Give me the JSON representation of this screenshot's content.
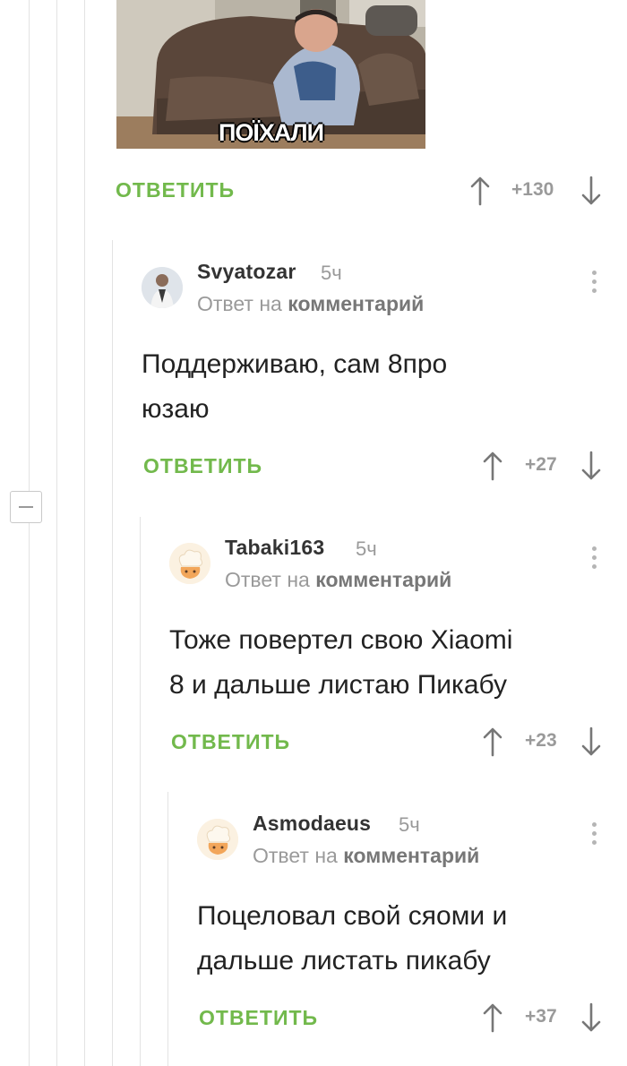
{
  "meme": {
    "caption": "ПОЇХАЛИ"
  },
  "top_actions": {
    "reply_label": "ОТВЕТИТЬ",
    "score": "+130"
  },
  "comments": [
    {
      "author": "Svyatozar",
      "time": "5ч",
      "reply_prefix": "Ответ на",
      "reply_link": "комментарий",
      "text_line1": "Поддерживаю, сам 8про",
      "text_line2": "юзаю",
      "reply_label": "ОТВЕТИТЬ",
      "score": "+27"
    },
    {
      "author": "Tabaki163",
      "time": "5ч",
      "reply_prefix": "Ответ на",
      "reply_link": "комментарий",
      "text_line1": "Тоже повертел свою Xiaomi",
      "text_line2": "8 и дальше листаю Пикабу",
      "reply_label": "ОТВЕТИТЬ",
      "score": "+23"
    },
    {
      "author": "Asmodaeus",
      "time": "5ч",
      "reply_prefix": "Ответ на",
      "reply_link": "комментарий",
      "text_line1": "Поцеловал свой сяоми и",
      "text_line2": "дальше листать пикабу",
      "reply_label": "ОТВЕТИТЬ",
      "score": "+37"
    }
  ],
  "icons": {
    "upvote": "arrow-up-icon",
    "downvote": "arrow-down-icon",
    "menu": "more-vertical-icon",
    "collapse": "minus-icon"
  },
  "colors": {
    "accent_green": "#72b94c",
    "muted_gray": "#9a9a9a",
    "text": "#222222"
  }
}
